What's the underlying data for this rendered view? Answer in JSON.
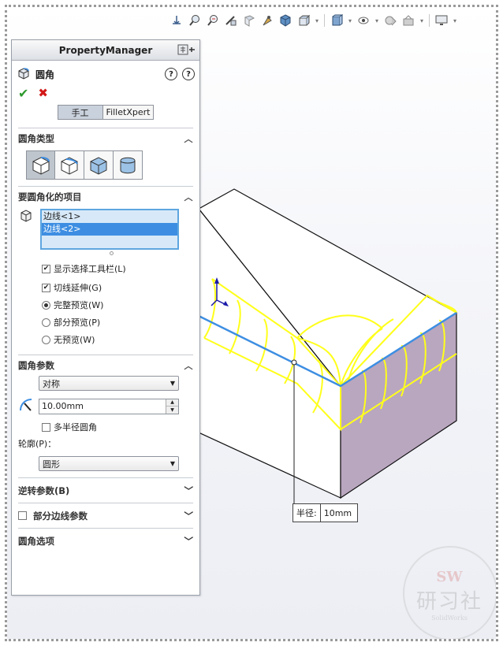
{
  "property_manager": {
    "header_title": "PropertyManager",
    "feature_title": "圆角",
    "mode_tabs": [
      "手工",
      "FilletXpert"
    ],
    "sections": {
      "fillet_type": {
        "title": "圆角类型",
        "selected_index": 0
      },
      "items_to_fillet": {
        "title": "要圆角化的项目",
        "list": [
          "边线<1>",
          "边线<2>"
        ],
        "highlighted_index": 1,
        "options": [
          {
            "label": "显示选择工具栏(L)",
            "checked": true
          },
          {
            "label": "切线延伸(G)",
            "checked": true
          }
        ],
        "preview": [
          {
            "label": "完整预览(W)",
            "selected": true
          },
          {
            "label": "部分预览(P)",
            "selected": false
          },
          {
            "label": "无预览(W)",
            "selected": false
          }
        ]
      },
      "fillet_params": {
        "title": "圆角参数",
        "method": "对称",
        "radius": "10.00mm",
        "multi_radius_label": "多半径圆角",
        "multi_radius_checked": false,
        "profile_label": "轮廓(P)：",
        "profile": "圆形"
      },
      "setback": {
        "title": "逆转参数(B)"
      },
      "partial_edge": {
        "title": "部分边线参数",
        "checked": false
      },
      "fillet_options": {
        "title": "圆角选项"
      }
    }
  },
  "callout": {
    "label": "半径:",
    "value": "10mm"
  },
  "watermark": {
    "line1": "SW",
    "line2": "研习社",
    "line3": "SolidWorks"
  },
  "colors": {
    "accent": "#3d8ee2",
    "preview": "#ffff1a",
    "face": "#b9a6bf",
    "ok": "#2e9a2e",
    "cancel": "#d21818"
  }
}
